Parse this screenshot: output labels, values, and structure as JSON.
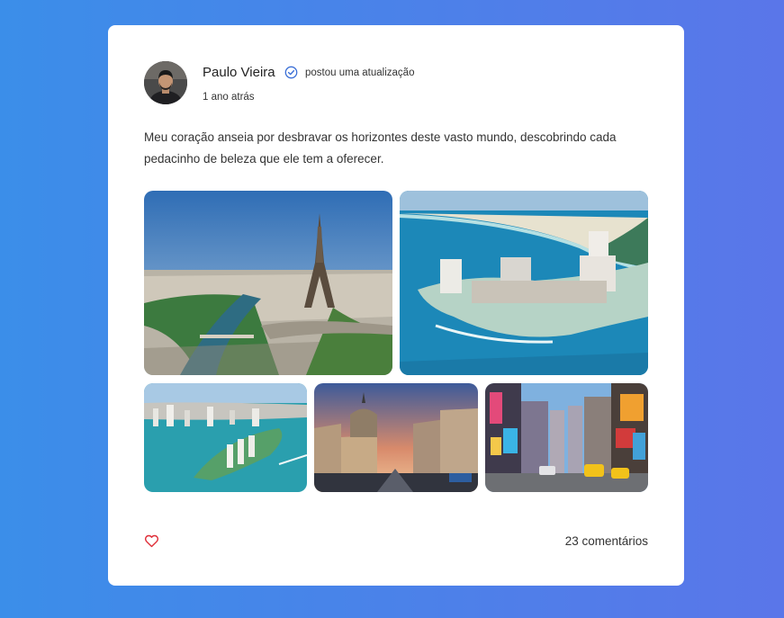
{
  "post": {
    "author_name": "Paulo Vieira",
    "action_text": "postou uma atualização",
    "timestamp": "1 ano atrás",
    "body": "Meu coração anseia por desbravar os horizontes deste vasto mundo, descobrindo cada pedacinho de beleza que ele tem a oferecer.",
    "comments_label": "23 comentários",
    "photos": [
      {
        "subject": "paris-eiffel-tower"
      },
      {
        "subject": "cancun-beach-resorts"
      },
      {
        "subject": "miami-island-skyline"
      },
      {
        "subject": "madrid-metropolis-building"
      },
      {
        "subject": "new-york-times-square"
      }
    ]
  },
  "icons": {
    "verified": "verified-check-icon",
    "like": "heart-icon"
  },
  "colors": {
    "background_start": "#3b8ee9",
    "background_end": "#5a76e9",
    "card": "#ffffff",
    "verified": "#3b6fd6",
    "heart": "#e0303a"
  }
}
